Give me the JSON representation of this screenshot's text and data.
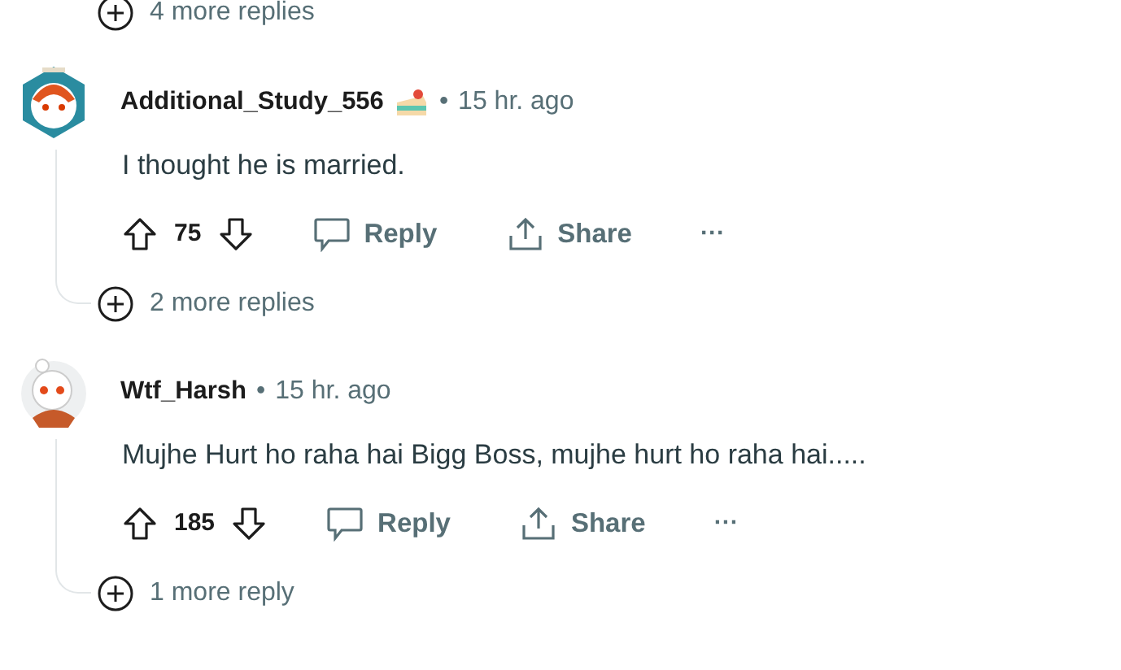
{
  "top_more": {
    "label": "4 more replies"
  },
  "comments": [
    {
      "kind": "hexagon",
      "username": "Additional_Study_556",
      "flair": true,
      "separator": "•",
      "time": "15 hr. ago",
      "body": "I thought he is married.",
      "score": "75",
      "reply": "Reply",
      "share": "Share",
      "more": "···",
      "more_replies": "2 more replies"
    },
    {
      "kind": "circle",
      "username": "Wtf_Harsh",
      "flair": false,
      "separator": "•",
      "time": "15 hr. ago",
      "body": "Mujhe Hurt ho raha hai Bigg Boss, mujhe hurt ho raha hai.....",
      "score": "185",
      "reply": "Reply",
      "share": "Share",
      "more": "···",
      "more_replies": "1 more reply"
    }
  ]
}
